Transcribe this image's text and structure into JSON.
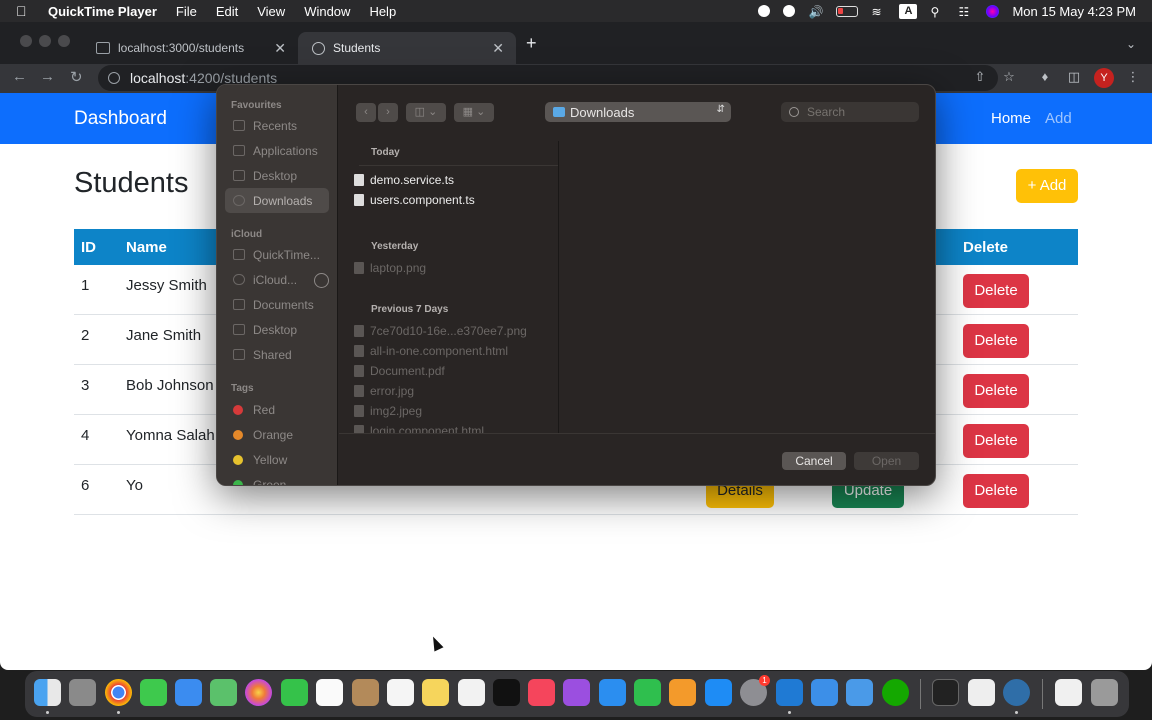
{
  "menubar": {
    "app_name": "QuickTime Player",
    "menus": [
      "File",
      "Edit",
      "View",
      "Window",
      "Help"
    ],
    "keyboard_indicator": "A",
    "clock": "Mon 15 May  4:23 PM"
  },
  "browser": {
    "tabs": [
      {
        "title": "localhost:3000/students",
        "active": false
      },
      {
        "title": "Students",
        "active": true
      }
    ],
    "url_host": "localhost",
    "url_rest": ":4200/students",
    "profile_initial": "Y"
  },
  "app": {
    "brand": "Dashboard",
    "nav_home": "Home",
    "nav_add": "Add",
    "page_title": "Students",
    "add_button": "+ Add",
    "columns": {
      "id": "ID",
      "name": "Name",
      "delete": "Delete"
    },
    "students": [
      {
        "id": "1",
        "name": "Jessy Smith"
      },
      {
        "id": "2",
        "name": "Jane Smith"
      },
      {
        "id": "3",
        "name": "Bob Johnson"
      },
      {
        "id": "4",
        "name": "Yomna Salah"
      },
      {
        "id": "6",
        "name": "Yo"
      }
    ],
    "delete_label": "Delete",
    "details_label": "Details",
    "update_label": "Update"
  },
  "dialog": {
    "sidebar": {
      "favourites_label": "Favourites",
      "favourites": [
        "Recents",
        "Applications",
        "Desktop",
        "Downloads"
      ],
      "icloud_label": "iCloud",
      "icloud": [
        "QuickTime...",
        "iCloud...",
        "Documents",
        "Desktop",
        "Shared"
      ],
      "tags_label": "Tags",
      "tags": [
        {
          "name": "Red",
          "color": "#d63a3a"
        },
        {
          "name": "Orange",
          "color": "#e5892a"
        },
        {
          "name": "Yellow",
          "color": "#e6c22e"
        },
        {
          "name": "Green",
          "color": "#3bb54a"
        }
      ]
    },
    "location": "Downloads",
    "search_placeholder": "Search",
    "groups": {
      "today": "Today",
      "yesterday": "Yesterday",
      "previous": "Previous 7 Days"
    },
    "files_today": [
      "demo.service.ts",
      "users.component.ts"
    ],
    "files_yesterday": [
      "laptop.png"
    ],
    "files_previous": [
      "7ce70d10-16e...e370ee7.png",
      "all-in-one.component.html",
      "Document.pdf",
      "error.jpg",
      "img2.jpeg",
      "login.component.html"
    ],
    "cancel_label": "Cancel",
    "open_label": "Open"
  }
}
